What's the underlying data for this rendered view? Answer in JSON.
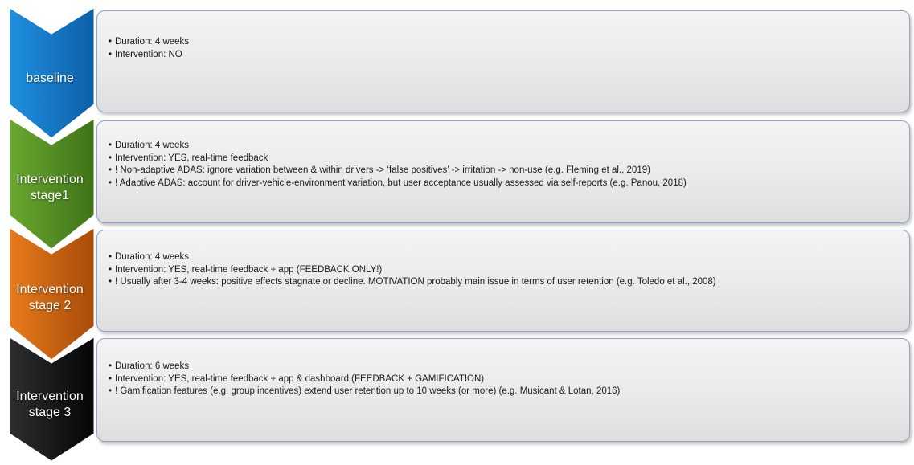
{
  "stages": [
    {
      "label_lines": [
        "baseline"
      ],
      "color": "#1f8fe0",
      "color_dark": "#0d5fa8",
      "bullets": [
        "Duration: 4 weeks",
        "Intervention: NO"
      ]
    },
    {
      "label_lines": [
        "Intervention",
        "stage1"
      ],
      "color": "#6aa830",
      "color_dark": "#3e7318",
      "bullets": [
        "Duration: 4 weeks",
        "Intervention: YES, real-time feedback",
        "! Non-adaptive ADAS: ignore variation between & within drivers -> ‘false positives’ -> irritation -> non-use (e.g. Fleming et al., 2019)",
        "! Adaptive ADAS: account for driver-vehicle-environment variation, but user acceptance usually assessed via self-reports (e.g. Panou, 2018)"
      ]
    },
    {
      "label_lines": [
        "Intervention",
        "stage 2"
      ],
      "color": "#e87a1c",
      "color_dark": "#a84c08",
      "bullets": [
        "Duration: 4 weeks",
        "Intervention: YES, real-time feedback + app (FEEDBACK ONLY!)",
        "! Usually after 3-4 weeks: positive effects stagnate or decline. MOTIVATION probably main issue in terms of user retention (e.g. Toledo et al., 2008)"
      ]
    },
    {
      "label_lines": [
        "Intervention",
        "stage 3"
      ],
      "color": "#2e2e2e",
      "color_dark": "#050505",
      "bullets": [
        "Duration: 6 weeks",
        "Intervention: YES, real-time feedback + app & dashboard (FEEDBACK + GAMIFICATION)",
        "! Gamification features (e.g. group incentives) extend user retention up to 10 weeks (or more) (e.g. Musicant & Lotan, 2016)"
      ]
    }
  ]
}
